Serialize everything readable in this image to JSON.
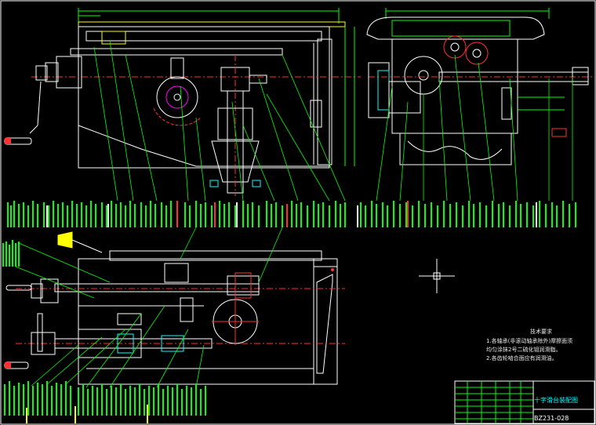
{
  "technical_requirements": {
    "heading": "技术要求",
    "lines": [
      "1.各轴承(非滚动轴承除外)摩擦面须",
      "  均匀涂抹2号二硫化钼润滑脂。",
      "2.各齿轮啮合面应有润滑油。"
    ]
  },
  "title_block": {
    "title": "十字滑台装配图",
    "drawing_no": "BZ231-028"
  },
  "colors": {
    "background": "#000000",
    "outline": "#ffffff",
    "leader": "#00ff00",
    "center_line": "#ff3030",
    "hatch": "#00ffff",
    "tag": "#ffff00",
    "magenta": "#ff00ff"
  },
  "icons": {
    "crosshair": "crosshair-icon",
    "handwheel": "handwheel-icon",
    "gear": "gear-icon"
  }
}
